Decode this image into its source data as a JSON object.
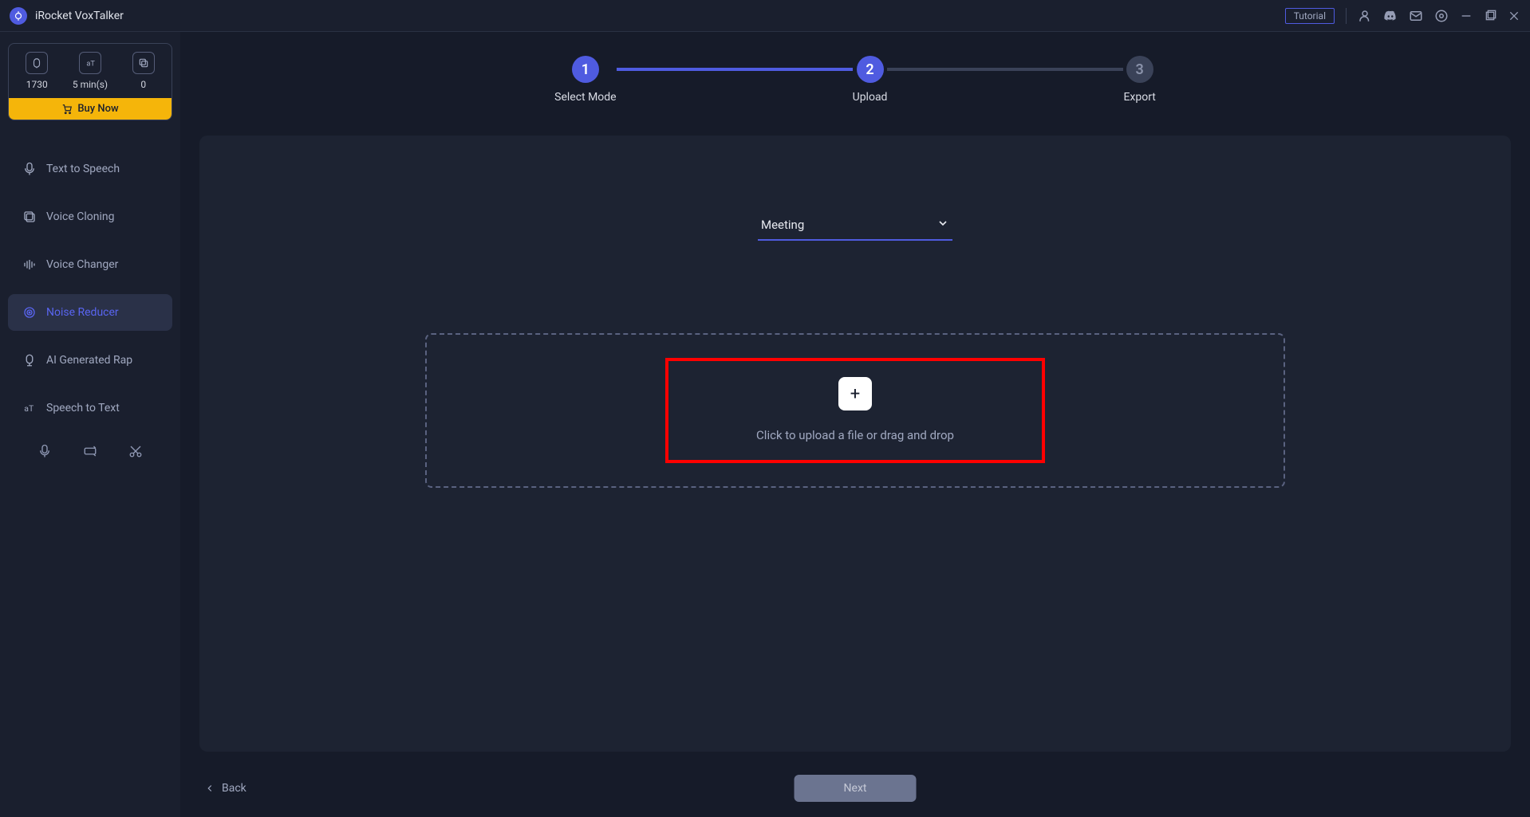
{
  "app": {
    "title": "iRocket VoxTalker"
  },
  "titlebar": {
    "tutorial": "Tutorial"
  },
  "credits": {
    "item1": "1730",
    "item2": "5 min(s)",
    "item3": "0",
    "buy_now": "Buy Now"
  },
  "sidebar": {
    "items": [
      {
        "label": "Text to Speech"
      },
      {
        "label": "Voice Cloning"
      },
      {
        "label": "Voice Changer"
      },
      {
        "label": "Noise Reducer"
      },
      {
        "label": "AI Generated Rap"
      },
      {
        "label": "Speech to Text"
      }
    ]
  },
  "steps": {
    "step1": {
      "num": "1",
      "label": "Select Mode"
    },
    "step2": {
      "num": "2",
      "label": "Upload"
    },
    "step3": {
      "num": "3",
      "label": "Export"
    }
  },
  "dropdown": {
    "selected": "Meeting"
  },
  "upload": {
    "plus": "+",
    "text": "Click to upload a file or drag and drop"
  },
  "footer": {
    "back": "Back",
    "next": "Next"
  }
}
